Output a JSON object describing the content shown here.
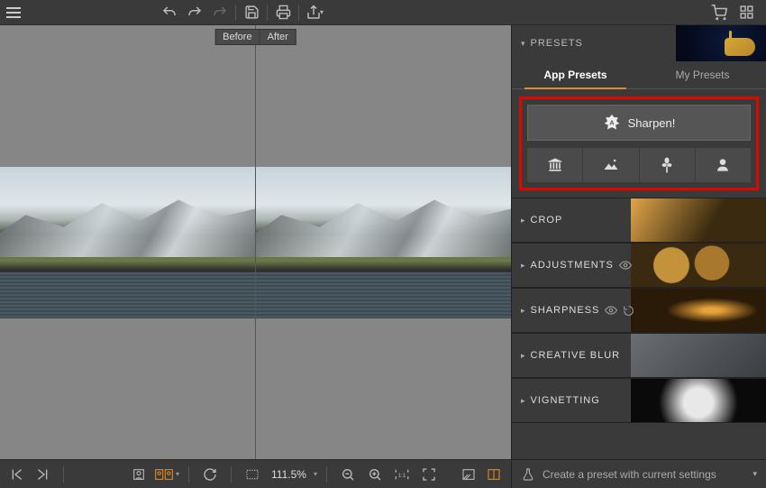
{
  "topbar": {
    "undo_icon": "undo",
    "redo_icon": "redo",
    "redo2_icon": "redo-again",
    "save_icon": "save",
    "print_icon": "print",
    "share_icon": "share",
    "cart_icon": "cart",
    "grid_icon": "grid"
  },
  "compare": {
    "before_label": "Before",
    "after_label": "After"
  },
  "bottombar": {
    "prev_icon": "prev",
    "next_icon": "next",
    "single_icon": "view-single",
    "split_icon": "view-split",
    "rotate_icon": "rotate",
    "ruler_icon": "ruler",
    "zoom_text": "111.5%",
    "zoom_out": "zoom-out",
    "zoom_in": "zoom-in",
    "fit_icon": "fit-1to1",
    "fit2_icon": "fit-screen",
    "compare_before": "show-before",
    "compare_split": "show-split"
  },
  "panel": {
    "presets_title": "PRESETS",
    "tabs": {
      "app": "App Presets",
      "my": "My Presets"
    },
    "sharpen_label": "Sharpen!",
    "sections": {
      "crop": "CROP",
      "adjustments": "ADJUSTMENTS",
      "sharpness": "SHARPNESS",
      "creative_blur": "CREATIVE BLUR",
      "vignetting": "VIGNETTING"
    },
    "footer": "Create a preset with current settings"
  }
}
